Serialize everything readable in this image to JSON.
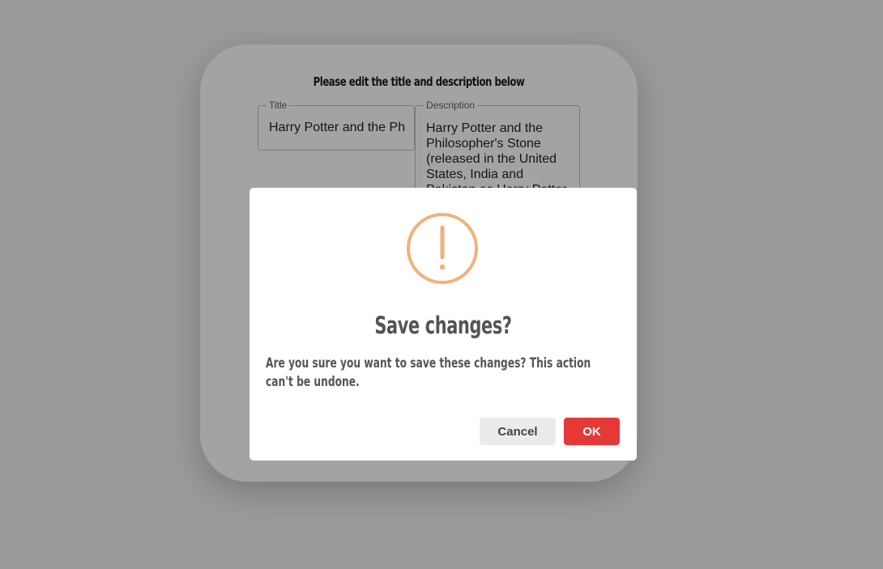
{
  "editor": {
    "heading": "Please edit the title and description below",
    "title_label": "Title",
    "title_value": "Harry Potter and the Ph",
    "description_label": "Description",
    "description_value": "Harry Potter and the Philosopher's Stone (released in the United States, India and Pakistan as Harry Potter"
  },
  "dialog": {
    "icon": "exclamation-circle-icon",
    "icon_color": "#f0b27a",
    "title": "Save changes?",
    "message": "Are you sure you want to save these changes? This action can't be undone.",
    "cancel_label": "Cancel",
    "ok_label": "OK",
    "ok_color": "#e53935"
  }
}
